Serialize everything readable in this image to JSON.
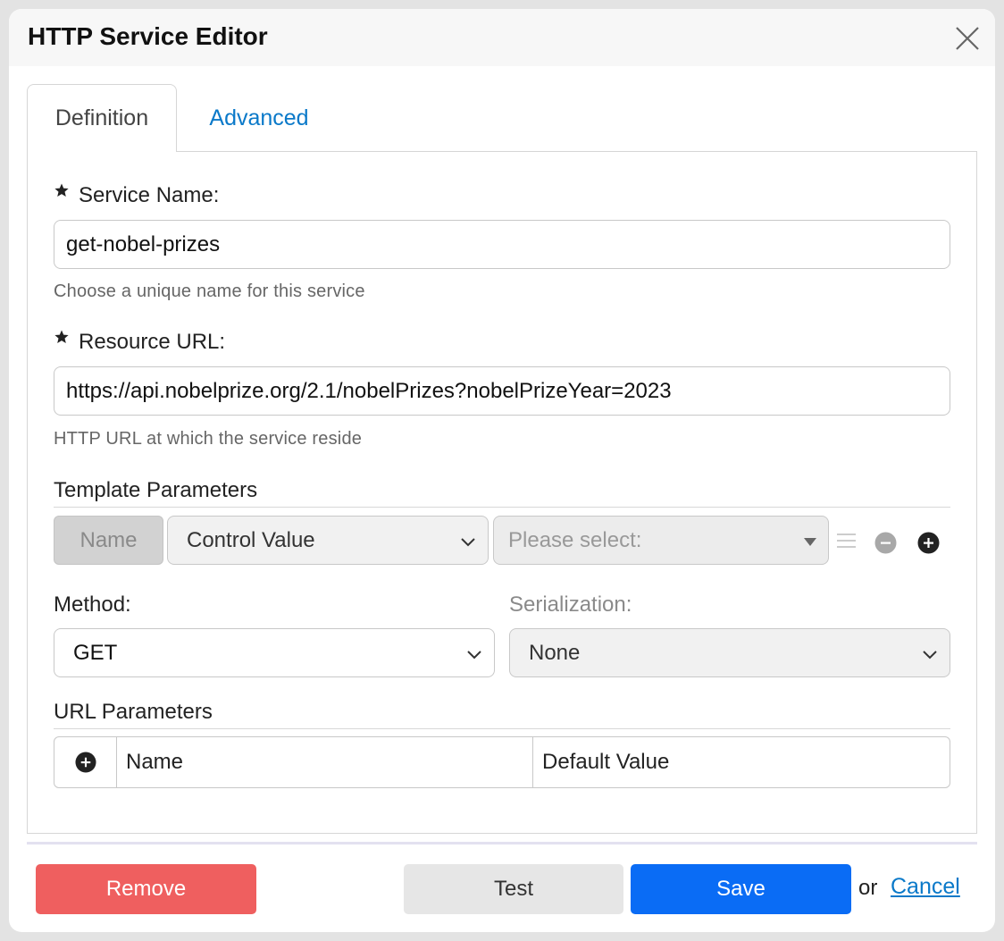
{
  "dialog": {
    "title": "HTTP Service Editor"
  },
  "tabs": [
    {
      "label": "Definition",
      "active": true
    },
    {
      "label": "Advanced",
      "active": false
    }
  ],
  "service_name": {
    "label": "Service Name:",
    "value": "get-nobel-prizes",
    "hint": "Choose a unique name for this service"
  },
  "resource_url": {
    "label": "Resource URL:",
    "value": "https://api.nobelprize.org/2.1/nobelPrizes?nobelPrizeYear=2023",
    "hint": "HTTP URL at which the service reside"
  },
  "template_parameters": {
    "title": "Template Parameters",
    "name_placeholder": "Name",
    "type_value": "Control Value",
    "control_placeholder": "Please select:"
  },
  "method": {
    "label": "Method:",
    "value": "GET"
  },
  "serialization": {
    "label": "Serialization:",
    "value": "None"
  },
  "url_parameters": {
    "title": "URL Parameters",
    "columns": [
      "Name",
      "Default Value"
    ]
  },
  "footer": {
    "remove_label": "Remove",
    "test_label": "Test",
    "save_label": "Save",
    "or_text": "or",
    "cancel_label": "Cancel"
  },
  "colors": {
    "accent_link": "#0a79c9",
    "save_button": "#0a6cf5",
    "remove_button": "#ef5f5f"
  }
}
